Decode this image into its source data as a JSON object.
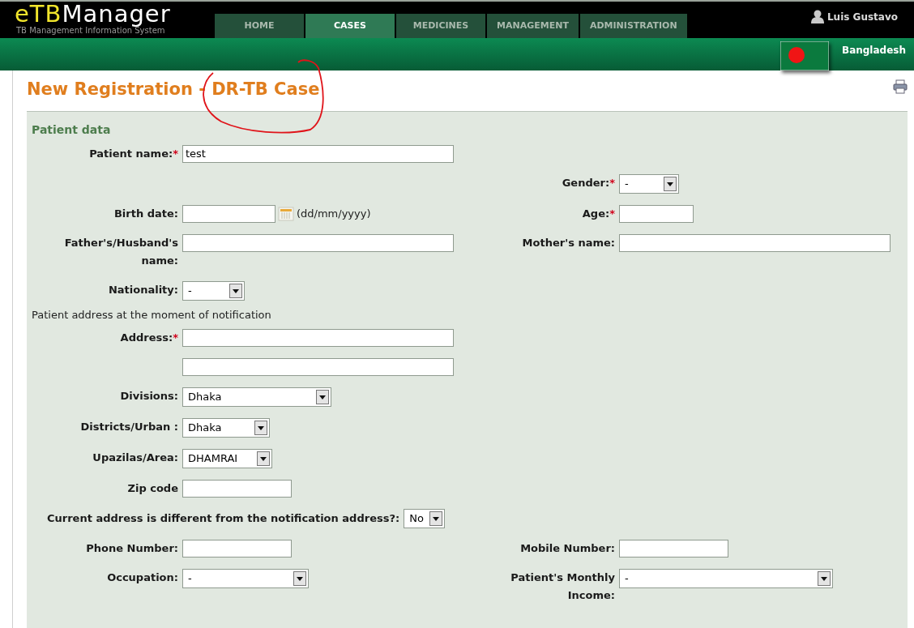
{
  "header": {
    "logo_prefix": "eTB",
    "logo_rest": "Manager",
    "subtitle": "TB Management Information System",
    "user": "Luis Gustavo",
    "country": "Bangladesh"
  },
  "nav": [
    {
      "label": "HOME",
      "selected": false
    },
    {
      "label": "CASES",
      "selected": true
    },
    {
      "label": "MEDICINES",
      "selected": false
    },
    {
      "label": "MANAGEMENT",
      "selected": false
    },
    {
      "label": "ADMINISTRATION",
      "selected": false
    }
  ],
  "page": {
    "title": "New Registration - DR-TB Case"
  },
  "section": {
    "title": "Patient data",
    "rows": [
      {
        "kind": "pair",
        "left": {
          "label": "Patient name:",
          "required_mark": "*",
          "kind": "text",
          "value": "test"
        }
      },
      {
        "kind": "pair",
        "right": {
          "label": "Gender:",
          "required_mark": "*",
          "kind": "select",
          "value": "-"
        }
      },
      {
        "kind": "pair",
        "left": {
          "label": "Birth date:",
          "kind": "date",
          "hint": "(dd/mm/yyyy)"
        },
        "right": {
          "label": "Age:",
          "required_mark": "*",
          "kind": "text"
        }
      },
      {
        "kind": "pair",
        "left": {
          "label": "Father's/Husband's name:",
          "kind": "text"
        },
        "right": {
          "label": "Mother's name:",
          "kind": "text"
        }
      },
      {
        "kind": "pair",
        "left": {
          "label": "Nationality:",
          "kind": "select",
          "value": "-"
        }
      },
      {
        "kind": "caption",
        "text": "Patient address at the moment of notification"
      },
      {
        "kind": "pair",
        "left": {
          "label": "Address:",
          "required_mark": "*",
          "kind": "text"
        }
      },
      {
        "kind": "pair",
        "left": {
          "kind": "text"
        }
      },
      {
        "kind": "pair",
        "left": {
          "label": "Divisions:",
          "kind": "select",
          "value": "Dhaka"
        }
      },
      {
        "kind": "pair",
        "left": {
          "label": "Districts/Urban :",
          "kind": "select",
          "value": "Dhaka"
        }
      },
      {
        "kind": "pair",
        "left": {
          "label": "Upazilas/Area:",
          "kind": "select",
          "value": "DHAMRAI"
        }
      },
      {
        "kind": "pair",
        "left": {
          "label": "Zip code",
          "kind": "text"
        }
      },
      {
        "kind": "wide",
        "field": {
          "label": "Current address is different from the notification address?:",
          "kind": "select",
          "value": "No"
        }
      },
      {
        "kind": "pair",
        "left": {
          "label": "Phone Number:",
          "kind": "text"
        },
        "right": {
          "label": "Mobile Number:",
          "kind": "text"
        }
      },
      {
        "kind": "pair",
        "left": {
          "label": "Occupation:",
          "kind": "select",
          "value": "-"
        },
        "right": {
          "label": "Patient's Monthly Income:",
          "kind": "select",
          "value": "-"
        }
      }
    ]
  }
}
